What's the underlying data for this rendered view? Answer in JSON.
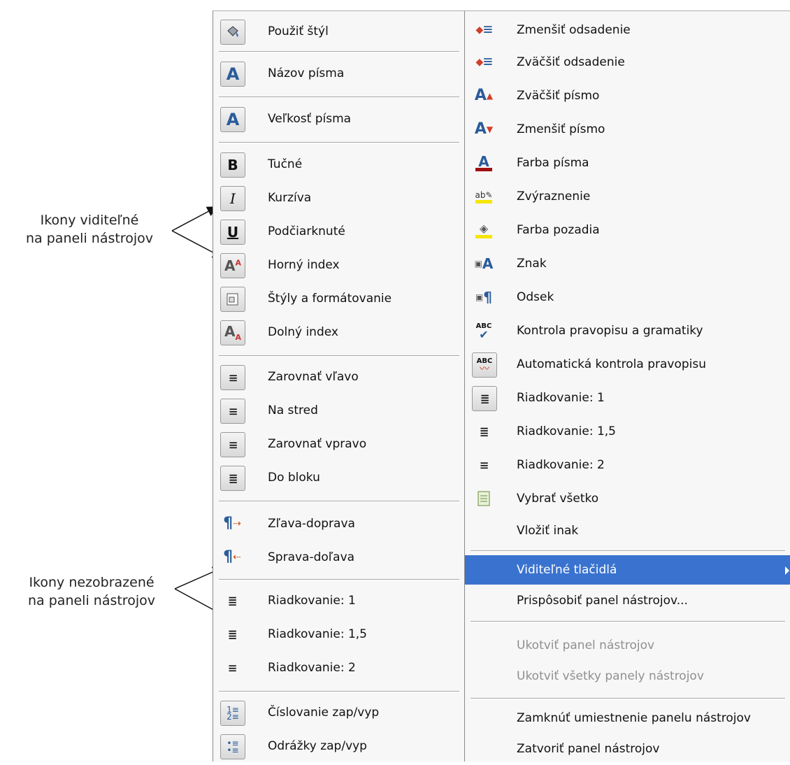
{
  "annotations": {
    "visible": [
      "Ikony viditeľné",
      "na paneli nástrojov"
    ],
    "hidden": [
      "Ikony nezobrazené",
      "na paneli nástrojov"
    ]
  },
  "left_menu": {
    "items": [
      {
        "label": "Použiť štýl",
        "icon": "paint-bucket-icon"
      },
      {
        "label": "Názov písma",
        "icon": "font-name-icon"
      },
      {
        "label": "Veľkosť písma",
        "icon": "font-size-icon"
      },
      {
        "label": "Tučné",
        "icon": "bold-icon"
      },
      {
        "label": "Kurzíva",
        "icon": "italic-icon"
      },
      {
        "label": "Podčiarknuté",
        "icon": "underline-icon"
      },
      {
        "label": "Horný index",
        "icon": "superscript-icon"
      },
      {
        "label": "Štýly a formátovanie",
        "icon": "styles-icon"
      },
      {
        "label": "Dolný index",
        "icon": "subscript-icon"
      },
      {
        "label": "Zarovnať vľavo",
        "icon": "align-left-icon"
      },
      {
        "label": "Na stred",
        "icon": "align-center-icon"
      },
      {
        "label": "Zarovnať vpravo",
        "icon": "align-right-icon"
      },
      {
        "label": "Do bloku",
        "icon": "justify-icon"
      },
      {
        "label": "Zľava-doprava",
        "icon": "ltr-icon"
      },
      {
        "label": "Sprava-doľava",
        "icon": "rtl-icon"
      },
      {
        "label": "Riadkovanie: 1",
        "icon": "line-spacing-1-icon"
      },
      {
        "label": "Riadkovanie: 1,5",
        "icon": "line-spacing-15-icon"
      },
      {
        "label": "Riadkovanie: 2",
        "icon": "line-spacing-2-icon"
      },
      {
        "label": "Číslovanie zap/vyp",
        "icon": "numbering-icon"
      },
      {
        "label": "Odrážky zap/vyp",
        "icon": "bullets-icon"
      }
    ]
  },
  "right_menu": {
    "items": [
      {
        "label": "Zmenšiť odsadenie",
        "icon": "decrease-indent-icon"
      },
      {
        "label": "Zväčšiť odsadenie",
        "icon": "increase-indent-icon"
      },
      {
        "label": "Zväčšiť písmo",
        "icon": "grow-font-icon"
      },
      {
        "label": "Zmenšiť písmo",
        "icon": "shrink-font-icon"
      },
      {
        "label": "Farba písma",
        "icon": "font-color-icon"
      },
      {
        "label": "Zvýraznenie",
        "icon": "highlight-icon"
      },
      {
        "label": "Farba pozadia",
        "icon": "background-color-icon"
      },
      {
        "label": "Znak",
        "icon": "character-icon"
      },
      {
        "label": "Odsek",
        "icon": "paragraph-icon"
      },
      {
        "label": "Kontrola pravopisu a gramatiky",
        "icon": "spellcheck-icon"
      },
      {
        "label": "Automatická kontrola pravopisu",
        "icon": "autospell-icon"
      },
      {
        "label": "Riadkovanie: 1",
        "icon": "line-spacing-1-icon"
      },
      {
        "label": "Riadkovanie: 1,5",
        "icon": "line-spacing-15-icon"
      },
      {
        "label": "Riadkovanie: 2",
        "icon": "line-spacing-2-icon"
      },
      {
        "label": "Vybrať všetko",
        "icon": "select-all-icon"
      },
      {
        "label": "Vložiť inak",
        "icon": ""
      },
      {
        "label": "Viditeľné tlačidlá",
        "icon": ""
      },
      {
        "label": "Prispôsobiť panel nástrojov...",
        "icon": ""
      },
      {
        "label": "Ukotviť panel nástrojov",
        "icon": ""
      },
      {
        "label": "Ukotviť všetky panely nástrojov",
        "icon": ""
      },
      {
        "label": "Zamknúť umiestnenie panelu nástrojov",
        "icon": ""
      },
      {
        "label": "Zatvoriť panel nástrojov",
        "icon": ""
      }
    ]
  },
  "colors": {
    "selection": "#3a73cf",
    "disabled_text": "#8f8f8f",
    "menu_bg": "#f7f7f7"
  }
}
